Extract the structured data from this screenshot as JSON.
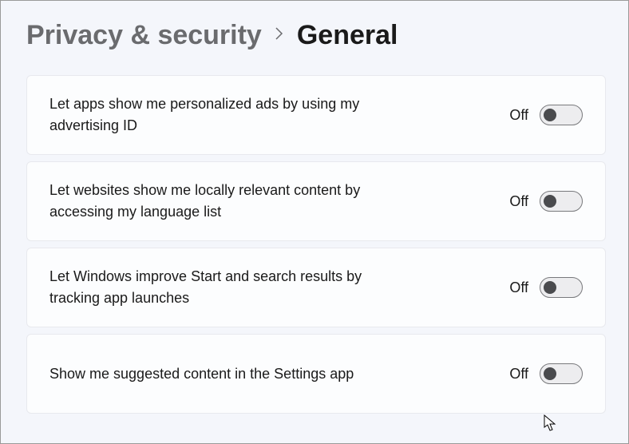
{
  "breadcrumb": {
    "parent": "Privacy & security",
    "current": "General"
  },
  "toggle_state_label": "Off",
  "settings": [
    {
      "id": "personalized-ads",
      "label": "Let apps show me personalized ads by using my advertising ID",
      "state": "Off"
    },
    {
      "id": "language-list",
      "label": "Let websites show me locally relevant content by accessing my language list",
      "state": "Off"
    },
    {
      "id": "track-app-launches",
      "label": "Let Windows improve Start and search results by tracking app launches",
      "state": "Off"
    },
    {
      "id": "suggested-content",
      "label": "Show me suggested content in the Settings app",
      "state": "Off"
    }
  ]
}
